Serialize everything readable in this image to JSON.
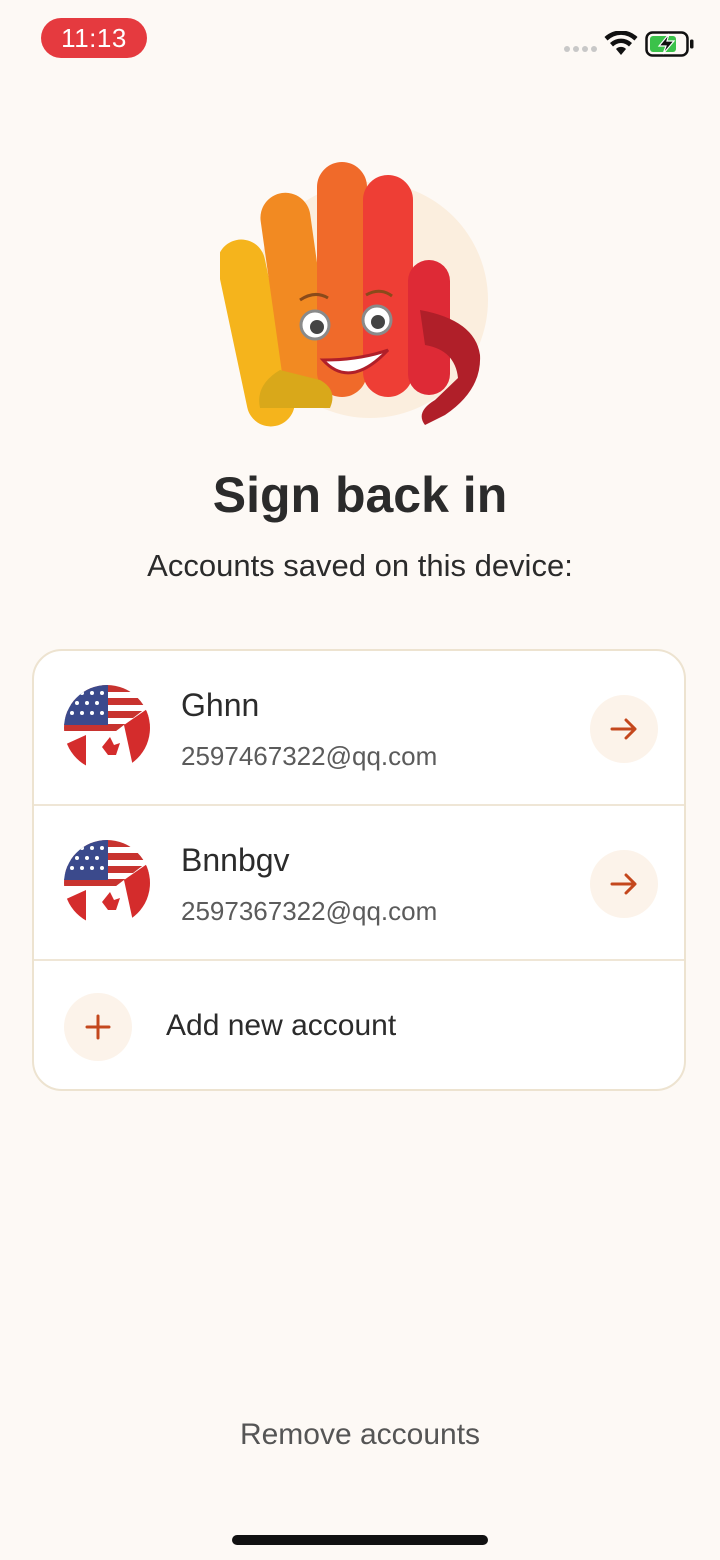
{
  "status_bar": {
    "time": "11:13",
    "icons": [
      "signal-icon",
      "wifi-icon",
      "battery-charging-icon"
    ]
  },
  "hero": {
    "image": "waving-hand-mascot"
  },
  "title": "Sign back in",
  "subtitle": "Accounts saved on this device:",
  "accounts": [
    {
      "name": "Ghnn",
      "email": "2597467322@qq.com",
      "avatar": "us-canada-flag",
      "action_icon": "arrow-right-icon"
    },
    {
      "name": "Bnnbgv",
      "email": "2597367322@qq.com",
      "avatar": "us-canada-flag",
      "action_icon": "arrow-right-icon"
    }
  ],
  "add_account": {
    "label": "Add new account",
    "icon": "plus-icon"
  },
  "remove_accounts": "Remove accounts",
  "colors": {
    "background": "#fdf9f5",
    "accent": "#c4471d",
    "time_pill": "#e53a3f",
    "card_border": "#ede3d0"
  }
}
